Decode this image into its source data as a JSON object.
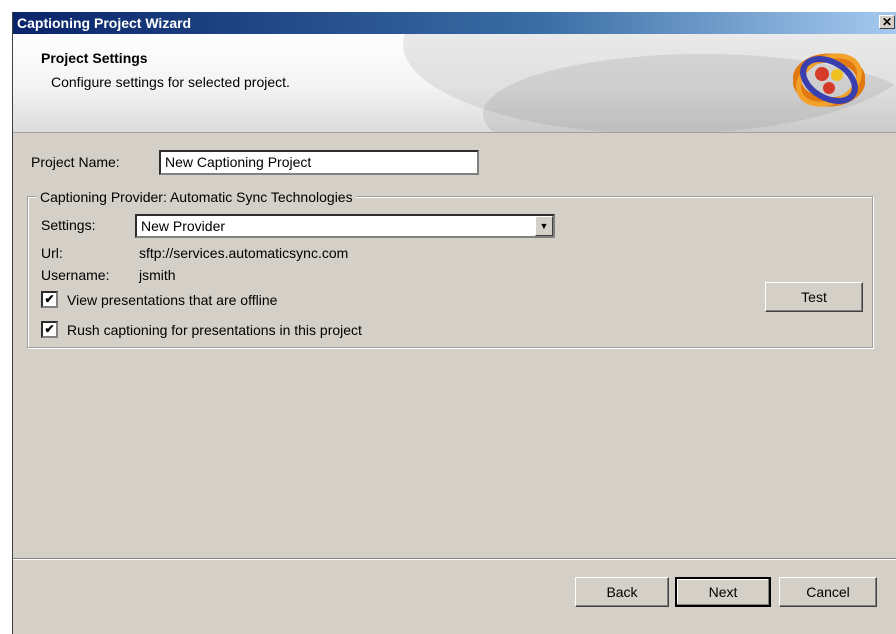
{
  "window": {
    "title": "Captioning Project Wizard",
    "close_glyph": "✕"
  },
  "header": {
    "title": "Project Settings",
    "subtitle": "Configure settings for selected project."
  },
  "form": {
    "project_name_label": "Project Name:",
    "project_name_value": "New Captioning Project"
  },
  "provider_group": {
    "legend": "Captioning Provider: Automatic Sync Technologies",
    "settings_label": "Settings:",
    "settings_value": "New Provider",
    "url_label": "Url:",
    "url_value": "sftp://services.automaticsync.com",
    "username_label": "Username:",
    "username_value": "jsmith",
    "checkbox_offline_label": "View presentations that are offline",
    "checkbox_offline_checked": true,
    "checkbox_rush_label": "Rush captioning for presentations in this project",
    "checkbox_rush_checked": true,
    "check_glyph": "✔",
    "test_button_label": "Test"
  },
  "footer": {
    "back_label": "Back",
    "next_label": "Next",
    "cancel_label": "Cancel"
  },
  "colors": {
    "titlebar": "#0a246a",
    "dialog_bg": "#d4d0c8"
  },
  "icons": {
    "close": "close-icon",
    "logo": "app-logo-icon",
    "dropdown": "chevron-down-icon",
    "check": "checkmark-icon"
  }
}
